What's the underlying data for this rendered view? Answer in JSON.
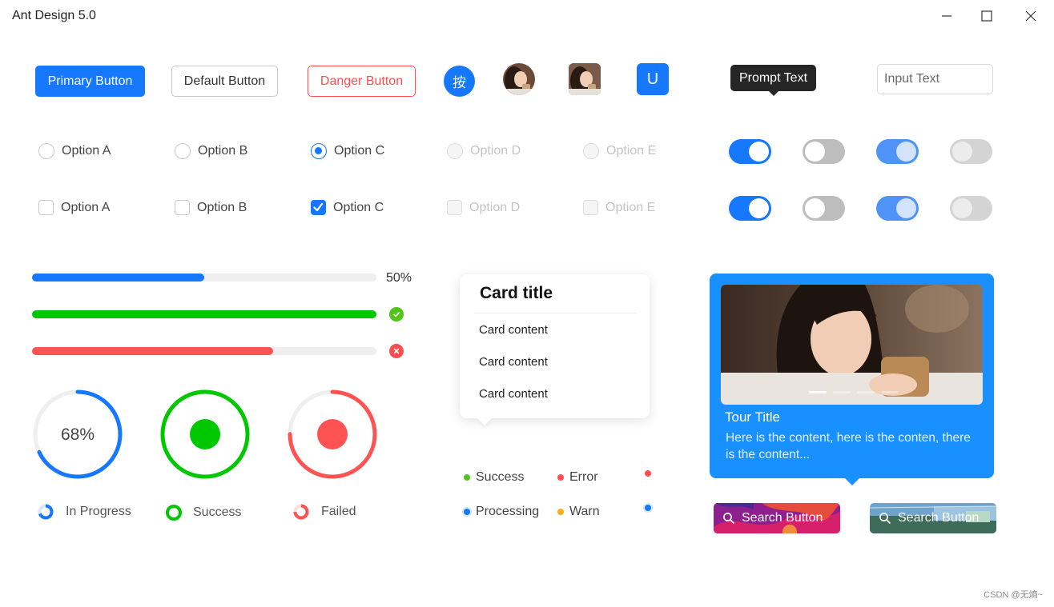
{
  "window": {
    "title": "Ant Design 5.0",
    "controls": {
      "minimize": "minimize-icon",
      "maximize": "maximize-icon",
      "close": "close-icon"
    }
  },
  "buttons": {
    "primary": "Primary Button",
    "default": "Default Button",
    "danger": "Danger Button"
  },
  "avatars": {
    "text_avatar": "按",
    "letter_avatar": "U"
  },
  "tooltip": {
    "text": "Prompt Text"
  },
  "input": {
    "placeholder": "Input Text",
    "value": ""
  },
  "radios": {
    "options": [
      "Option A",
      "Option B",
      "Option C",
      "Option D",
      "Option E"
    ],
    "selected": "Option C",
    "disabled": [
      "Option D",
      "Option E"
    ]
  },
  "checkboxes": {
    "options": [
      "Option A",
      "Option B",
      "Option C",
      "Option D",
      "Option E"
    ],
    "checked": [
      "Option C"
    ],
    "disabled": [
      "Option D",
      "Option E"
    ]
  },
  "switches": [
    {
      "on": true,
      "disabled": false
    },
    {
      "on": false,
      "disabled": false
    },
    {
      "on": true,
      "disabled": true
    },
    {
      "on": false,
      "disabled": true
    }
  ],
  "progress_bars": [
    {
      "percent": 50,
      "status": "normal",
      "label": "50%",
      "color": "#1677ff"
    },
    {
      "percent": 100,
      "status": "success",
      "color": "#00c800"
    },
    {
      "percent": 70,
      "status": "exception",
      "color": "#ff5252"
    }
  ],
  "progress_circles": [
    {
      "percent": 68,
      "status": "normal",
      "label": "68%",
      "color": "#1677ff"
    },
    {
      "percent": 100,
      "status": "success",
      "color": "#00c800"
    },
    {
      "percent": 75,
      "status": "exception",
      "color": "#ff5252"
    }
  ],
  "circle_legend": [
    {
      "label": "In Progress",
      "color": "#1677ff"
    },
    {
      "label": "Success",
      "color": "#00c800"
    },
    {
      "label": "Failed",
      "color": "#ff5252"
    }
  ],
  "card": {
    "title": "Card title",
    "items": [
      "Card content",
      "Card content",
      "Card content"
    ]
  },
  "badges": [
    {
      "label": "Success",
      "color": "#52c41a"
    },
    {
      "label": "Error",
      "color": "#ff4d4f"
    },
    {
      "label": "",
      "color": "#ff4d4f"
    },
    {
      "label": "Processing",
      "color": "#1677ff"
    },
    {
      "label": "Warn",
      "color": "#faad14"
    },
    {
      "label": "",
      "color": "#1677ff"
    }
  ],
  "tour": {
    "title": "Tour Title",
    "content": "Here is the content, here is the conten, there is the content...",
    "slides": 4,
    "active_slide": 1
  },
  "search_buttons": [
    {
      "label": "Search Button",
      "background": "colorful-wave-image"
    },
    {
      "label": "Search Button",
      "background": "scenery-image"
    }
  ],
  "watermark": "CSDN @无熵~",
  "colors": {
    "primary": "#1677ff",
    "success": "#00c800",
    "danger": "#ff4d4f",
    "tour_bg": "#1890ff"
  }
}
